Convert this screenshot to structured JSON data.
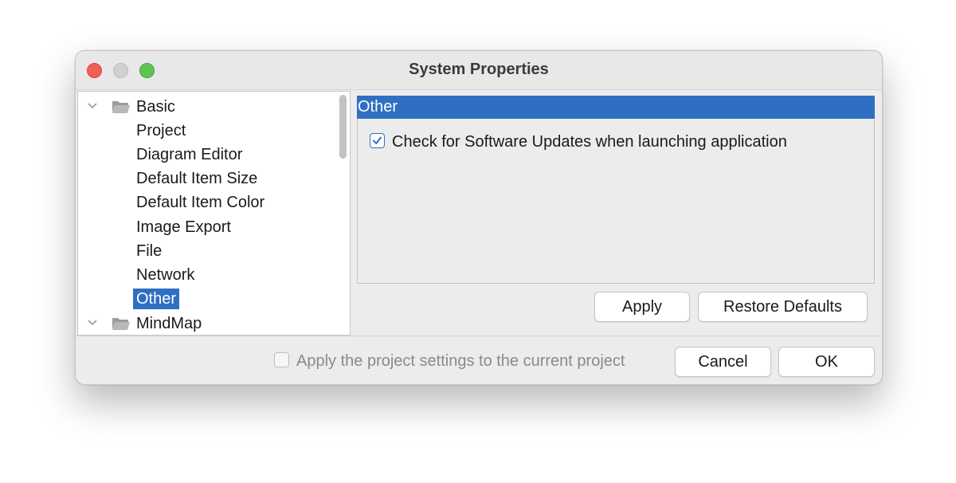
{
  "window": {
    "title": "System Properties"
  },
  "tree": {
    "items": [
      {
        "label": "Basic",
        "type": "group"
      },
      {
        "label": "Project",
        "type": "leaf"
      },
      {
        "label": "Diagram Editor",
        "type": "leaf"
      },
      {
        "label": "Default Item Size",
        "type": "leaf"
      },
      {
        "label": "Default Item Color",
        "type": "leaf"
      },
      {
        "label": "Image Export",
        "type": "leaf"
      },
      {
        "label": "File",
        "type": "leaf"
      },
      {
        "label": "Network",
        "type": "leaf"
      },
      {
        "label": "Other",
        "type": "leaf",
        "selected": true
      },
      {
        "label": "MindMap",
        "type": "group"
      }
    ]
  },
  "panel": {
    "header": "Other",
    "check_updates": {
      "label": "Check for Software Updates when launching application",
      "checked": true
    }
  },
  "buttons": {
    "apply": "Apply",
    "restore_defaults": "Restore Defaults",
    "cancel": "Cancel",
    "ok": "OK"
  },
  "footer": {
    "apply_project": {
      "label": "Apply the project settings to the current project",
      "checked": false,
      "enabled": false
    }
  },
  "colors": {
    "selection": "#2f6fc2",
    "close": "#ee5f58",
    "zoom": "#5fc452"
  }
}
